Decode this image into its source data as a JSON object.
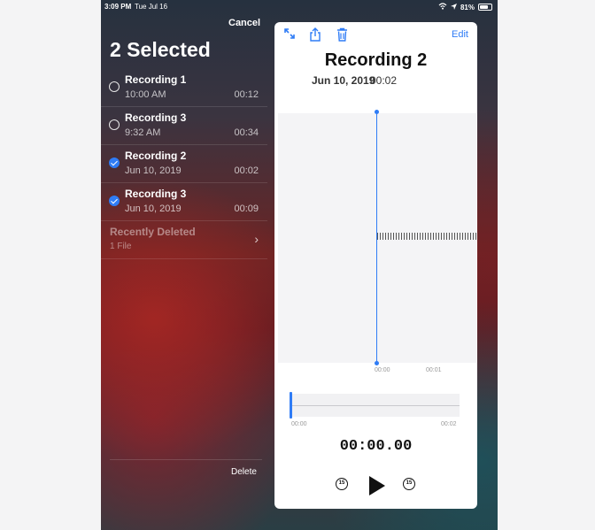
{
  "status": {
    "time": "3:09 PM",
    "date": "Tue Jul 16",
    "battery": "81%"
  },
  "sidebar": {
    "cancel_label": "Cancel",
    "title": "2 Selected",
    "recordings": [
      {
        "name": "Recording 1",
        "date": "10:00 AM",
        "duration": "00:12",
        "selected": false
      },
      {
        "name": "Recording 3",
        "date": "9:32 AM",
        "duration": "00:34",
        "selected": false
      },
      {
        "name": "Recording 2",
        "date": "Jun 10, 2019",
        "duration": "00:02",
        "selected": true
      },
      {
        "name": "Recording 3",
        "date": "Jun 10, 2019",
        "duration": "00:09",
        "selected": true
      }
    ],
    "recently_deleted": {
      "title": "Recently Deleted",
      "count": "1 File"
    },
    "delete_label": "Delete"
  },
  "detail": {
    "edit_label": "Edit",
    "title": "Recording 2",
    "date": "Jun 10, 2019",
    "duration": "00:02",
    "wave_ticks": [
      "00:00",
      "00:01"
    ],
    "scrub_start": "00:00",
    "scrub_end": "00:02",
    "playback_time": "00:00.00",
    "skip_back": "15",
    "skip_forward": "15"
  },
  "colors": {
    "accent": "#2f7cf6"
  },
  "icons": [
    "expand-icon",
    "share-icon",
    "trash-icon",
    "play-icon",
    "skip-back-15-icon",
    "skip-forward-15-icon",
    "chevron-right-icon",
    "wifi-icon",
    "battery-icon"
  ]
}
